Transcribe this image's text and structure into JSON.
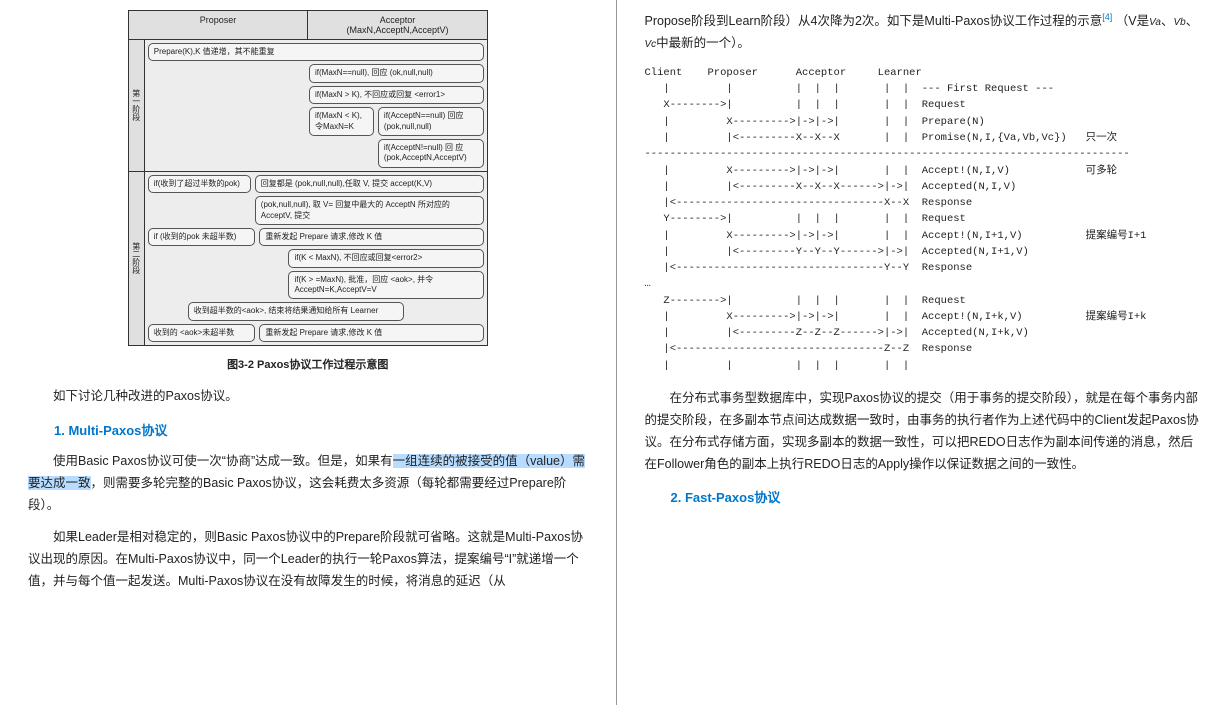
{
  "diagram": {
    "header_proposer": "Proposer",
    "header_acceptor": "Acceptor\n(MaxN,AcceptN,AcceptV)",
    "caption": "图3-2 Paxos协议工作过程示意图",
    "phase1_label": "第一阶段",
    "phase2_label": "第二阶段",
    "box_prepare": "Prepare(K),K 值递增，其不能重复",
    "box_p1a": "if(MaxN==null), 回应 (ok,null,null)",
    "box_p1b": "if(MaxN > K), 不回应或回复 <error1>",
    "box_p1c_left": "if(MaxN < K), 令MaxN=K",
    "box_p1c_right": "if(AcceptN==null) 回应 (pok,null,null)",
    "box_p1d": "if(AcceptN!=null) 回 应(pok,AcceptN,AcceptV)",
    "box_p2a_left": "if(收到了超过半数的pok)",
    "box_p2a_right": "回复都是 (pok,null,null),任取 V, 提交 accept(K,V)",
    "box_p2b": "(pok,null,null), 取 V= 回复中最大的 AcceptN 所对应的 AcceptV, 提交",
    "box_p2c_left": "if (收到的pok 未超半数)",
    "box_p2c_right": "重新发起 Prepare 请求,修改 K 值",
    "box_p2d": "if(K < MaxN), 不回应或回复<error2>",
    "box_p2e": "if(K > =MaxN), 批准，回应 <aok>, 并令AcceptN=K,AcceptV=V",
    "box_p2f": "收到超半数的<aok>, 结束将结果通知给所有 Learner",
    "box_p2g_left": "收到的 <aok>未超半数",
    "box_p2g_right": "重新发起 Prepare 请求,修改 K 值"
  },
  "left": {
    "intro": "如下讨论几种改进的Paxos协议。",
    "h1": "1. Multi-Paxos协议",
    "p1a": "使用Basic Paxos协议可使一次“协商”达成一致。但是，如果有",
    "p1_hl": "一组连续的被接受的值（value）需要达成一致",
    "p1b": "，则需要多轮完整的Basic Paxos协议，这会耗费太多资源（每轮都需要经过Prepare阶段）。",
    "p2": "如果Leader是相对稳定的，则Basic Paxos协议中的Prepare阶段就可省略。这就是Multi-Paxos协议出现的原因。在Multi-Paxos协议中，同一个Leader的执行一轮Paxos算法，提案编号“I”就递增一个值，并与每个值一起发送。Multi-Paxos协议在没有故障发生的时候，将消息的延迟（从"
  },
  "right": {
    "p1a": "Propose阶段到Learn阶段）从4次降为2次。如下是Multi-Paxos协议工作过程的示意",
    "p1_ref": "[4]",
    "p1b": "（V是",
    "p1_va": "Va",
    "p1c": "、",
    "p1_vb": "Vb",
    "p1d": "、",
    "p1_vc": "Vc",
    "p1e": "中最新的一个）。",
    "diagram_text": "Client    Proposer      Acceptor     Learner\n   |         |          |  |  |       |  |  --- First Request ---\n   X-------->|          |  |  |       |  |  Request\n   |         X--------->|->|->|       |  |  Prepare(N)\n   |         |<---------X--X--X       |  |  Promise(N,I,{Va,Vb,Vc})   只一次\n-----------------------------------------------------------------------------\n   |         X--------->|->|->|       |  |  Accept!(N,I,V)            可多轮\n   |         |<---------X--X--X------>|->|  Accepted(N,I,V)\n   |<---------------------------------X--X  Response\n   Y-------->|          |  |  |       |  |  Request\n   |         X--------->|->|->|       |  |  Accept!(N,I+1,V)          提案编号I+1\n   |         |<---------Y--Y--Y------>|->|  Accepted(N,I+1,V)\n   |<---------------------------------Y--Y  Response\n…\n   Z-------->|          |  |  |       |  |  Request\n   |         X--------->|->|->|       |  |  Accept!(N,I+k,V)          提案编号I+k\n   |         |<---------Z--Z--Z------>|->|  Accepted(N,I+k,V)\n   |<---------------------------------Z--Z  Response\n   |         |          |  |  |       |  |",
    "p2": "在分布式事务型数据库中，实现Paxos协议的提交（用于事务的提交阶段），就是在每个事务内部的提交阶段，在多副本节点间达成数据一致时，由事务的执行者作为上述代码中的Client发起Paxos协议。在分布式存储方面，实现多副本的数据一致性，可以把REDO日志作为副本间传递的消息，然后在Follower角色的副本上执行REDO日志的Apply操作以保证数据之间的一致性。",
    "h2": "2. Fast-Paxos协议"
  }
}
